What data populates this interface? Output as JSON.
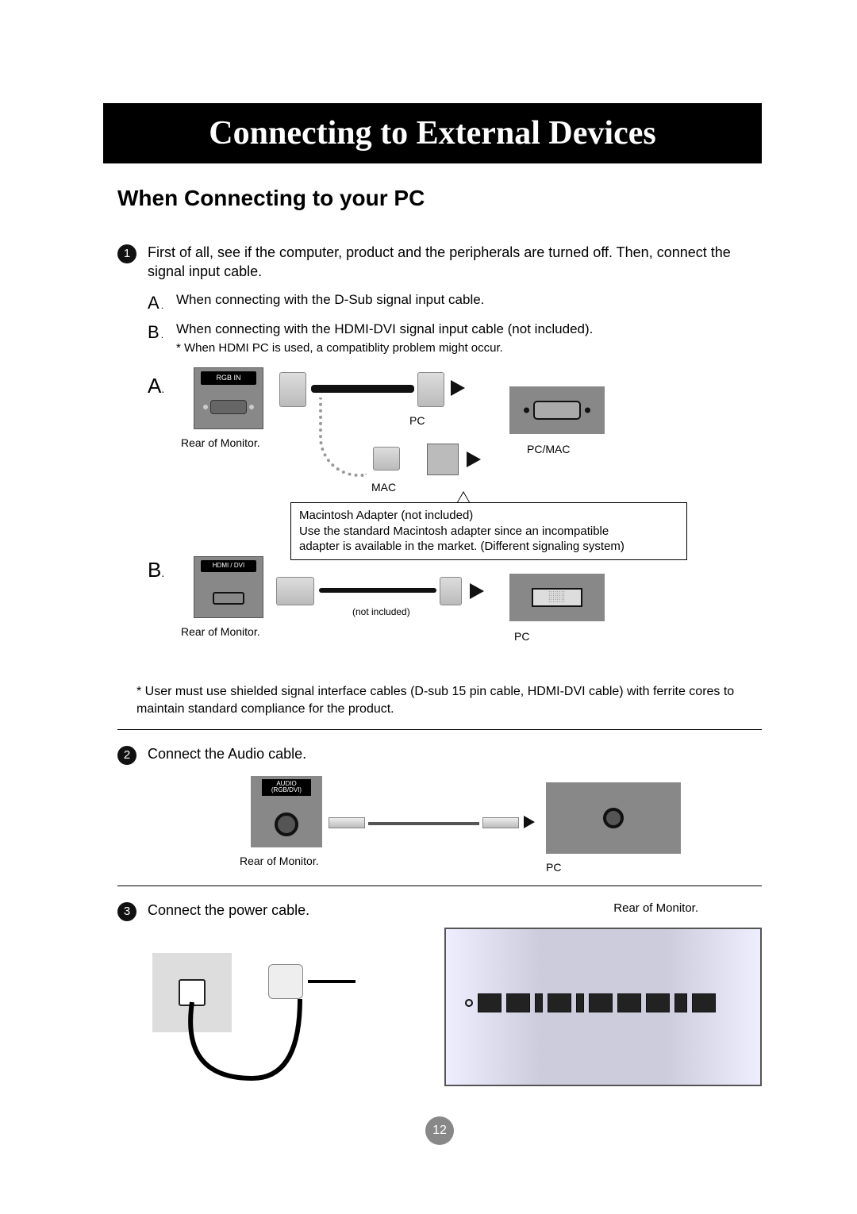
{
  "header": {
    "title": "Connecting to External Devices"
  },
  "subtitle": "When Connecting to your PC",
  "step1": {
    "num": "1",
    "text": "First of all, see if the computer, product and the peripherals are turned off. Then, connect the signal input cable.",
    "A_label": "A",
    "A_text": "When connecting with the D-Sub signal input cable.",
    "B_label": "B",
    "B_text": "When connecting with the HDMI-DVI signal input cable (not included).",
    "B_sub": "* When HDMI PC is used, a compatiblity problem might occur."
  },
  "diagramA": {
    "big": "A",
    "port_top": "RGB IN",
    "rear_label": "Rear of Monitor.",
    "pc_label": "PC",
    "mac_label": "MAC",
    "pcmac_label": "PC/MAC"
  },
  "callout": {
    "line1": "Macintosh Adapter (not included)",
    "line2": "Use the standard Macintosh adapter since an incompatible",
    "line3": "adapter is available in the market. (Different signaling system)"
  },
  "diagramB": {
    "big": "B",
    "port_top": "HDMI / DVI",
    "rear_label": "Rear of Monitor.",
    "not_included": "(not included)",
    "pc_label": "PC"
  },
  "foot1": "* User must use shielded signal interface cables (D-sub 15 pin cable,  HDMI-DVI cable) with ferrite cores to maintain standard compliance for the product.",
  "step2": {
    "num": "2",
    "text": "Connect the Audio cable.",
    "audio_top1": "AUDIO",
    "audio_top2": "(RGB/DVI)",
    "rear_label": "Rear of Monitor.",
    "pc_label": "PC"
  },
  "step3": {
    "num": "3",
    "text": "Connect the power cable.",
    "rear_label": "Rear of Monitor."
  },
  "page_number": "12"
}
